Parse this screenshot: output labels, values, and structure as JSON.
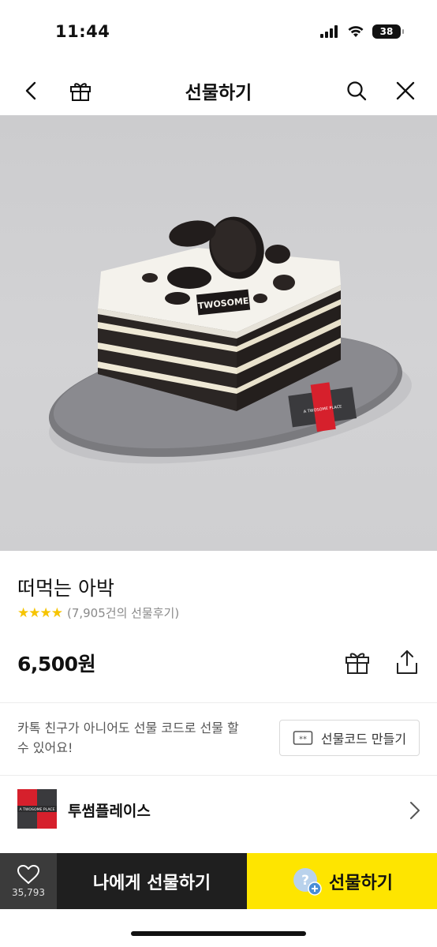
{
  "status": {
    "time": "11:44",
    "battery": "38"
  },
  "header": {
    "title": "선물하기"
  },
  "hero": {
    "plate_label": "TWOSOME"
  },
  "product": {
    "name": "떠먹는 아박",
    "stars": "★★★★",
    "rating": 4,
    "review_count": "(7,905건의 선물후기)",
    "price": "6,500원"
  },
  "gift_code": {
    "description": "카톡 친구가 아니어도 선물 코드로 선물 할 수 있어요!",
    "button_label": "선물코드 만들기"
  },
  "brand": {
    "name": "투썸플레이스",
    "logo_text": "A TWOSOME PLACE"
  },
  "bottom_bar": {
    "like_count": "35,793",
    "self_gift_label": "나에게 선물하기",
    "gift_label": "선물하기"
  },
  "colors": {
    "kakao_yellow": "#fee500",
    "star": "#f6c400",
    "dark_button": "#1f1f1f",
    "brand_red": "#d6202c"
  },
  "icons": [
    "back-icon",
    "gift-icon",
    "search-icon",
    "close-icon",
    "heart-icon",
    "share-icon",
    "ticket-icon",
    "chevron-right-icon",
    "signal-icon",
    "wifi-icon"
  ]
}
